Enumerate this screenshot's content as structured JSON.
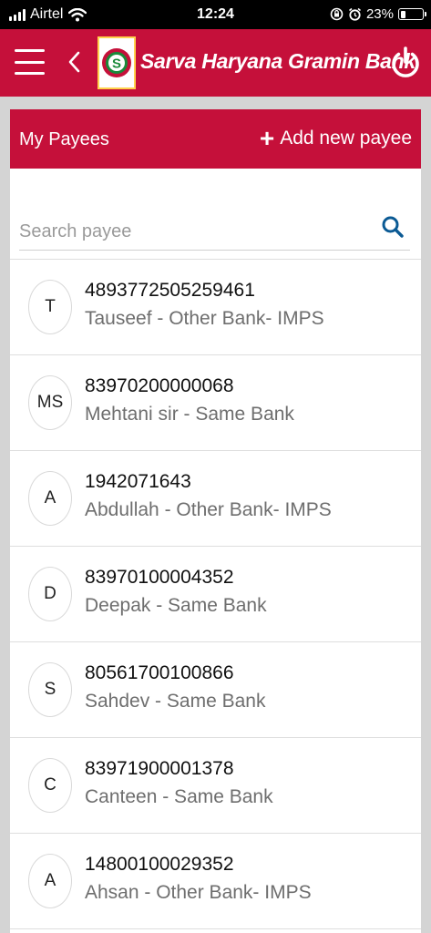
{
  "status_bar": {
    "carrier": "Airtel",
    "time": "12:24",
    "battery": "23%",
    "battery_level": 0.23,
    "icons": [
      "signal-icon",
      "wifi-icon",
      "rotation-lock-icon",
      "alarm-icon",
      "battery-icon"
    ]
  },
  "header": {
    "bank_name": "Sarva Haryana Gramin Bank",
    "icons": [
      "menu-icon",
      "back-icon",
      "bank-logo",
      "power-icon"
    ],
    "brand_color": "#c5103a"
  },
  "payees_card": {
    "title": "My Payees",
    "add_label": "Add new payee",
    "search_placeholder": "Search payee",
    "search_value": "",
    "payees": [
      {
        "initials": "T",
        "account": "4893772505259461",
        "description": "Tauseef - Other Bank- IMPS"
      },
      {
        "initials": "MS",
        "account": "83970200000068",
        "description": "Mehtani sir - Same Bank"
      },
      {
        "initials": "A",
        "account": "1942071643",
        "description": "Abdullah - Other Bank- IMPS"
      },
      {
        "initials": "D",
        "account": "83970100004352",
        "description": "Deepak - Same Bank"
      },
      {
        "initials": "S",
        "account": "80561700100866",
        "description": "Sahdev - Same Bank"
      },
      {
        "initials": "C",
        "account": "83971900001378",
        "description": "Canteen - Same Bank"
      },
      {
        "initials": "A",
        "account": "14800100029352",
        "description": "Ahsan - Other Bank- IMPS"
      }
    ]
  }
}
